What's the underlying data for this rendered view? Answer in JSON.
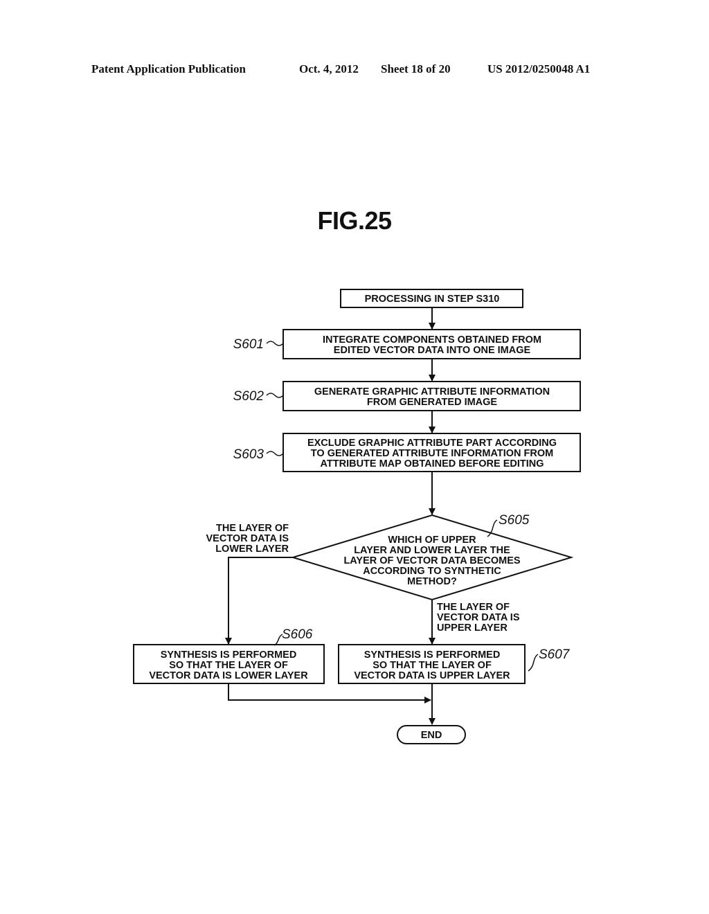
{
  "header": {
    "publication": "Patent Application Publication",
    "date": "Oct. 4, 2012",
    "sheet": "Sheet 18 of 20",
    "number": "US 2012/0250048 A1"
  },
  "figure": {
    "title": "FIG.25",
    "start": {
      "lines": [
        "PROCESSING IN STEP S310"
      ]
    },
    "steps": [
      {
        "id": "S601",
        "lines": [
          "INTEGRATE COMPONENTS OBTAINED FROM",
          "EDITED VECTOR DATA INTO ONE IMAGE"
        ]
      },
      {
        "id": "S602",
        "lines": [
          "GENERATE GRAPHIC ATTRIBUTE INFORMATION",
          "FROM GENERATED IMAGE"
        ]
      },
      {
        "id": "S603",
        "lines": [
          "EXCLUDE GRAPHIC ATTRIBUTE PART ACCORDING",
          "TO GENERATED ATTRIBUTE INFORMATION FROM",
          "ATTRIBUTE MAP OBTAINED BEFORE EDITING"
        ]
      }
    ],
    "decision": {
      "id": "S605",
      "lines": [
        "WHICH OF UPPER",
        "LAYER AND LOWER LAYER THE",
        "LAYER OF VECTOR DATA BECOMES",
        "ACCORDING TO SYNTHETIC",
        "METHOD?"
      ],
      "branch_left": [
        "THE LAYER OF",
        "VECTOR DATA IS",
        "LOWER LAYER"
      ],
      "branch_down": [
        "THE LAYER OF",
        "VECTOR DATA IS",
        "UPPER LAYER"
      ]
    },
    "left_step": {
      "id": "S606",
      "lines": [
        "SYNTHESIS IS PERFORMED",
        "SO THAT THE LAYER OF",
        "VECTOR DATA IS LOWER LAYER"
      ]
    },
    "right_step": {
      "id": "S607",
      "lines": [
        "SYNTHESIS IS PERFORMED",
        "SO THAT THE LAYER OF",
        "VECTOR DATA IS UPPER LAYER"
      ]
    },
    "end": {
      "label": "END"
    }
  }
}
